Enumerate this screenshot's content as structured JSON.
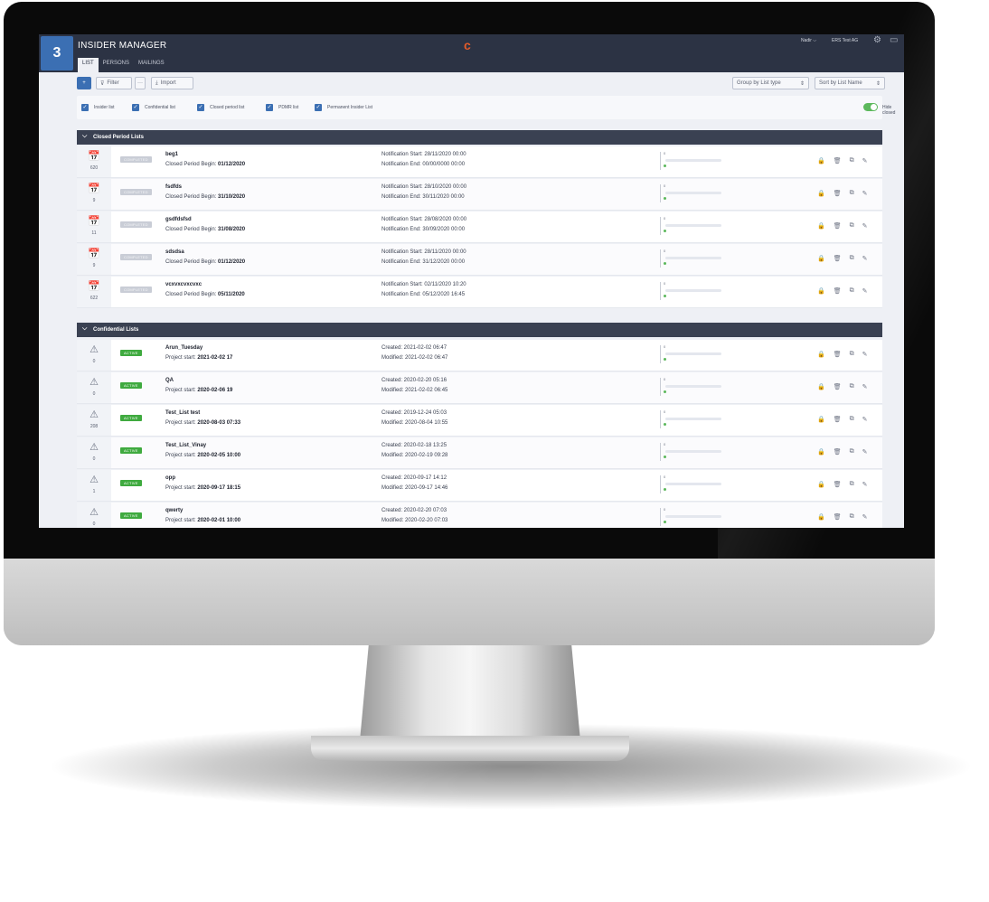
{
  "app": {
    "title": "INSIDER MANAGER",
    "brand_glyph": "c",
    "logo_glyph": "3"
  },
  "header": {
    "user": "Nadir ⌵",
    "company": "ERS Test AG",
    "settings_glyph": "⚙",
    "messages_glyph": "▭"
  },
  "tabs": [
    {
      "label": "LIST"
    },
    {
      "label": "PERSONS"
    },
    {
      "label": "MAILINGS"
    }
  ],
  "toolbar": {
    "add_glyph": "+",
    "filter_label": "Filter",
    "more_label": "···",
    "import_label": "Import",
    "group_by_label": "Group by List type",
    "sort_label": "Sort by List Name"
  },
  "filters": {
    "items": [
      {
        "label": "Insider list"
      },
      {
        "label": "Confidential list"
      },
      {
        "label": "Closed period list"
      },
      {
        "label": "PDMR list"
      },
      {
        "label": "Permanent Insider List"
      }
    ],
    "hide_closed_label": "Hide closed"
  },
  "groups": [
    {
      "title": "Closed Period Lists",
      "rows": [
        {
          "icon": "📅",
          "count": "620",
          "status": "COMPLETED",
          "name": "beg1",
          "sub_label": "Closed Period Begin:",
          "sub_value": "01/12/2020",
          "meta1": "Notification Start: 28/11/2020 00:00",
          "meta2": "Notification End: 00/00/0000 00:00",
          "progress_value": "0"
        },
        {
          "icon": "📅",
          "count": "9",
          "status": "COMPLETED",
          "name": "fsdfds",
          "sub_label": "Closed Period Begin:",
          "sub_value": "31/10/2020",
          "meta1": "Notification Start: 28/10/2020 00:00",
          "meta2": "Notification End: 30/11/2020 00:00",
          "progress_value": "0"
        },
        {
          "icon": "📅",
          "count": "11",
          "status": "COMPLETED",
          "name": "gsdfdsfsd",
          "sub_label": "Closed Period Begin:",
          "sub_value": "31/08/2020",
          "meta1": "Notification Start: 28/08/2020 00:00",
          "meta2": "Notification End: 30/09/2020 00:00",
          "progress_value": "0"
        },
        {
          "icon": "📅",
          "count": "9",
          "status": "COMPLETED",
          "name": "sdsdsa",
          "sub_label": "Closed Period Begin:",
          "sub_value": "01/12/2020",
          "meta1": "Notification Start: 28/11/2020 00:00",
          "meta2": "Notification End: 31/12/2020 00:00",
          "progress_value": "0"
        },
        {
          "icon": "📅",
          "count": "622",
          "status": "COMPLETED",
          "name": "vcxvxcvxcvxc",
          "sub_label": "Closed Period Begin:",
          "sub_value": "05/11/2020",
          "meta1": "Notification Start: 02/11/2020 10:20",
          "meta2": "Notification End: 05/12/2020 16:45",
          "progress_value": "0"
        }
      ]
    },
    {
      "title": "Confidential Lists",
      "rows": [
        {
          "icon": "⚠",
          "count": "0",
          "status": "ACTIVE",
          "name": "Arun_Tuesday",
          "sub_label": "Project start:",
          "sub_value": "2021-02-02 17",
          "meta1": "Created: 2021-02-02 06:47",
          "meta2": "Modified: 2021-02-02 06:47",
          "progress_value": "0"
        },
        {
          "icon": "⚠",
          "count": "0",
          "status": "ACTIVE",
          "name": "QA",
          "sub_label": "Project start:",
          "sub_value": "2020-02-06 19",
          "meta1": "Created: 2020-02-20 05:16",
          "meta2": "Modified: 2021-02-02 06:45",
          "progress_value": "0"
        },
        {
          "icon": "⚠",
          "count": "208",
          "status": "ACTIVE",
          "name": "Test_List test",
          "sub_label": "Project start:",
          "sub_value": "2020-08-03 07:33",
          "meta1": "Created: 2019-12-24 05:03",
          "meta2": "Modified: 2020-08-04 10:55",
          "progress_value": "0"
        },
        {
          "icon": "⚠",
          "count": "0",
          "status": "ACTIVE",
          "name": "Test_List_Vinay",
          "sub_label": "Project start:",
          "sub_value": "2020-02-05 10:00",
          "meta1": "Created: 2020-02-18 13:25",
          "meta2": "Modified: 2020-02-19 09:28",
          "progress_value": "0"
        },
        {
          "icon": "⚠",
          "count": "1",
          "status": "ACTIVE",
          "name": "opp",
          "sub_label": "Project start:",
          "sub_value": "2020-09-17 18:15",
          "meta1": "Created: 2020-09-17 14:12",
          "meta2": "Modified: 2020-09-17 14:46",
          "progress_value": "0"
        },
        {
          "icon": "⚠",
          "count": "0",
          "status": "ACTIVE",
          "name": "qwerty",
          "sub_label": "Project start:",
          "sub_value": "2020-02-01 10:00",
          "meta1": "Created: 2020-02-20 07:03",
          "meta2": "Modified: 2020-02-20 07:03",
          "progress_value": "0"
        }
      ]
    }
  ],
  "action_icons": [
    "🔒",
    "🗑",
    "⧉",
    "✎"
  ]
}
